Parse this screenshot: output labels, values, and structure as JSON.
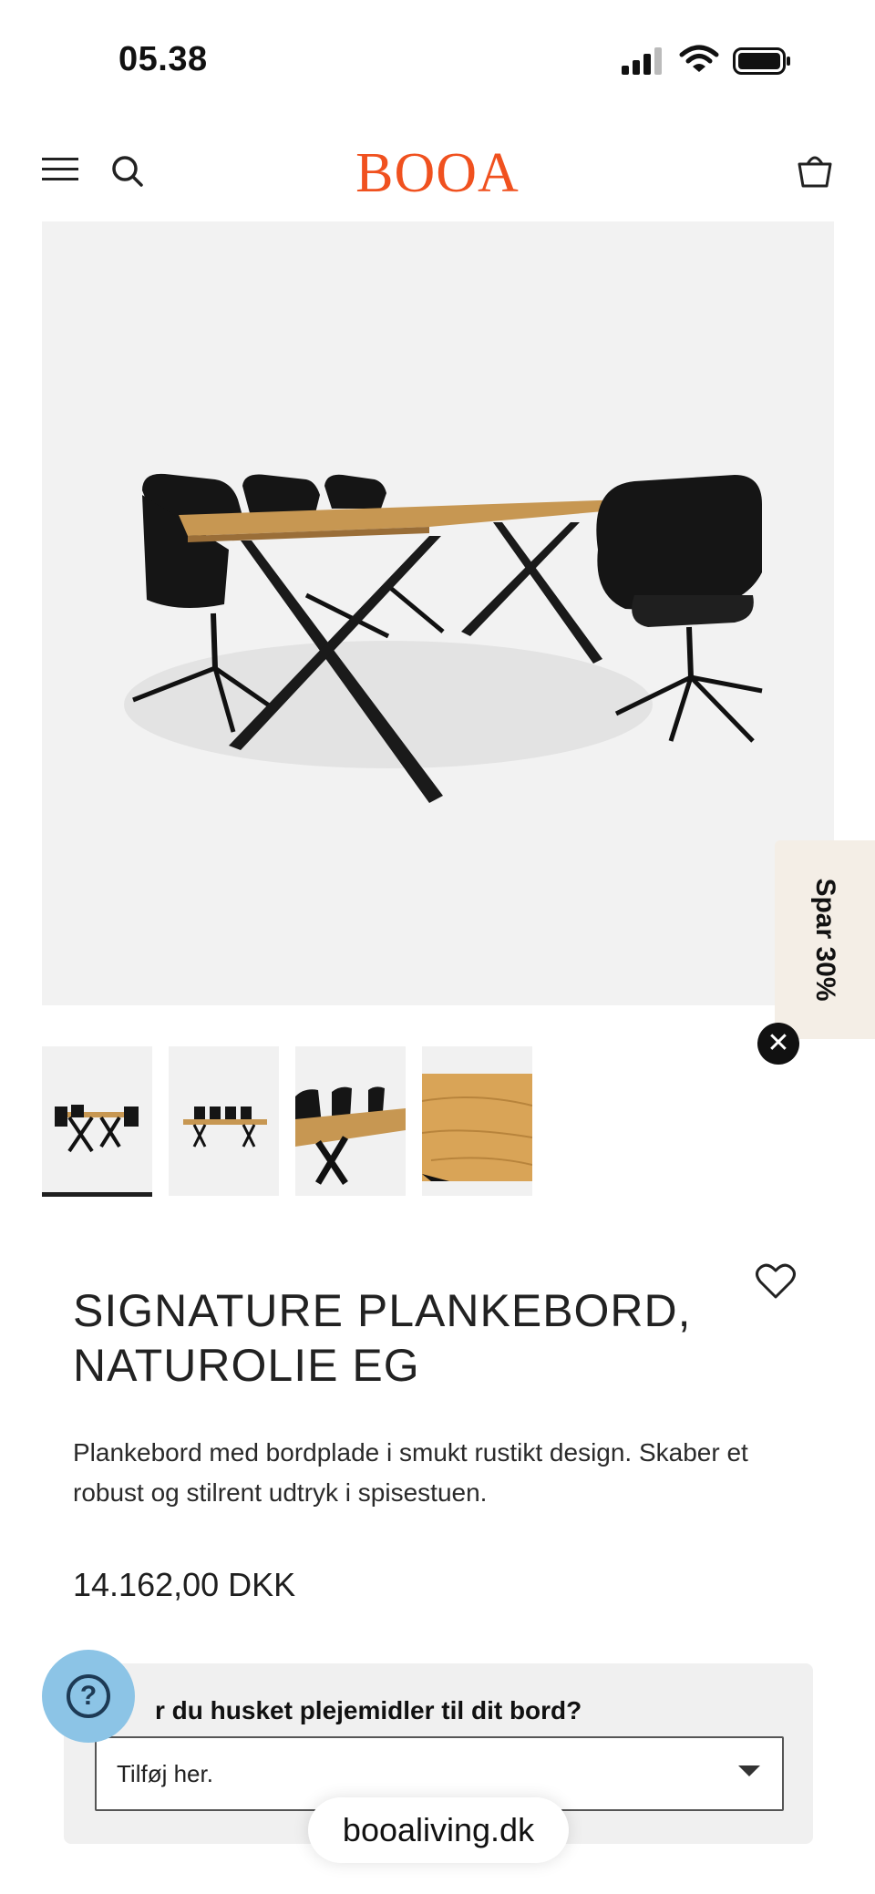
{
  "status_bar": {
    "time": "05.38"
  },
  "header": {
    "logo": "BOOA"
  },
  "hero": {
    "image_desc": "dining-table-with-chairs"
  },
  "promo": {
    "tab_label": "Spar 30%",
    "close_symbol": "✕"
  },
  "thumbnails": {
    "count": 4,
    "active_index": 0
  },
  "product": {
    "title": "SIGNATURE PLANKEBORD, NATUROLIE EG",
    "description": "Plankebord med bordplade i smukt rustikt design. Skaber et robust og stilrent udtryk i spisestuen.",
    "price": "14.162,00 DKK"
  },
  "upsell": {
    "question": "r du husket plejemidler til dit bord?",
    "select_value": "Tilføj her."
  },
  "help": {
    "symbol": "?"
  },
  "browser": {
    "url": "booaliving.dk"
  },
  "colors": {
    "brand": "#f0511f",
    "help_bubble": "#8cc4e6",
    "promo_tab": "#f4eee6"
  }
}
